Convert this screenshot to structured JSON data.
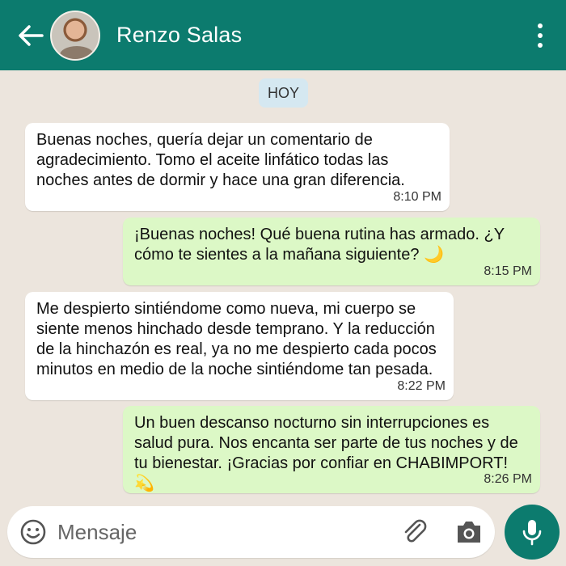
{
  "header": {
    "contact_name": "Renzo Salas",
    "icons": [
      "back-arrow-icon",
      "avatar",
      "more-vert-icon"
    ],
    "color": "#0c7b6e"
  },
  "chat": {
    "day_label": "HOY",
    "messages": [
      {
        "direction": "in",
        "text": "Buenas noches, quería dejar un comentario de agradecimiento. Tomo el aceite linfático todas las noches antes de dormir y hace una gran diferencia.",
        "time": "8:10 PM"
      },
      {
        "direction": "out",
        "text": "¡Buenas noches! Qué buena rutina has armado. ¿Y cómo te sientes a la mañana siguiente? 🌙",
        "time": "8:15 PM"
      },
      {
        "direction": "in",
        "text": "Me despierto sintiéndome como nueva, mi cuerpo se siente menos hinchado desde temprano. Y la reducción de la hinchazón es real, ya no me despierto cada pocos minutos en medio de la noche sintiéndome tan pesada.",
        "time": "8:22 PM"
      },
      {
        "direction": "out",
        "text": "Un buen descanso nocturno sin interrupciones es salud pura. Nos encanta ser parte de tus noches y de tu bienestar. ¡Gracias por confiar en CHABIMPORT! 💫",
        "time": "8:26 PM"
      }
    ]
  },
  "composer": {
    "placeholder": "Mensaje",
    "icons": [
      "emoji-icon",
      "paperclip-icon",
      "camera-icon",
      "mic-icon"
    ]
  },
  "colors": {
    "incoming_bubble": "#ffffff",
    "outgoing_bubble": "#dcf8c6",
    "background": "#ece5dd",
    "accent": "#0c7b6e"
  }
}
